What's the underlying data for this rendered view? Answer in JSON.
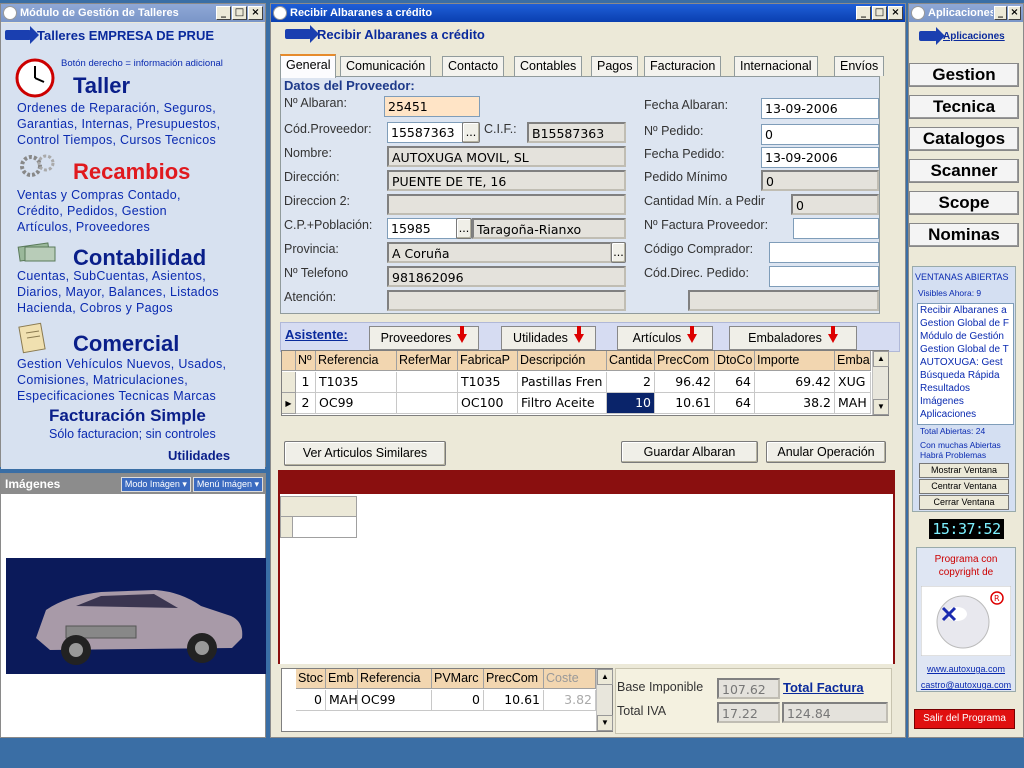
{
  "left_window": {
    "title": "Módulo de Gestión de Talleres",
    "header": "Talleres EMPRESA DE PRUE",
    "hint": "Botón derecho = información adicional",
    "modules": [
      {
        "title": "Taller",
        "lines": [
          "Ordenes de Reparación, Seguros,",
          "Garantias, Internas, Presupuestos,",
          "Control Tiempos, Cursos Tecnicos"
        ]
      },
      {
        "title": "Recambios",
        "lines": [
          "Ventas y Compras Contado,",
          "Crédito, Pedidos,  Gestion",
          "Artículos, Proveedores"
        ]
      },
      {
        "title": "Contabilidad",
        "lines": [
          "Cuentas, SubCuentas, Asientos,",
          "Diarios, Mayor, Balances, Listados",
          "Hacienda, Cobros y Pagos"
        ]
      },
      {
        "title": "Comercial",
        "lines": [
          "Gestion Vehículos Nuevos, Usados,",
          "Comisiones, Matriculaciones,",
          "Especificaciones Tecnicas Marcas"
        ]
      }
    ],
    "fact_simple_title": "Facturación Simple",
    "fact_simple_sub": "Sólo facturacion; sin controles",
    "utilidades": "Utilidades"
  },
  "images_panel": {
    "title": "Imágenes",
    "mode_btn": "Modo Imágen",
    "menu_btn": "Menú Imágen"
  },
  "main_window": {
    "title": "Recibir Albaranes a crédito",
    "header": "Recibir Albaranes a crédito",
    "tabs": [
      "General",
      "Comunicación",
      "Contacto",
      "Contables",
      "Pagos",
      "Facturacion",
      "Internacional",
      "Envíos"
    ],
    "section_title": "Datos del Proveedor:",
    "fields": {
      "albaran_label": "Nº Albaran:",
      "albaran": "25451",
      "cod_prov_label": "Cód.Proveedor:",
      "cod_prov": "15587363",
      "cif_label": "C.I.F.:",
      "cif": "B15587363",
      "nombre_label": "Nombre:",
      "nombre": "AUTOXUGA MOVIL, SL",
      "direccion_label": "Dirección:",
      "direccion": "PUENTE DE TE, 16",
      "direccion2_label": "Direccion 2:",
      "direccion2": "",
      "cp_label": "C.P.+Población:",
      "cp": "15985",
      "poblacion": "Taragoña-Rianxo",
      "provincia_label": "Provincia:",
      "provincia": "A Coruña",
      "telefono_label": "Nº Telefono",
      "telefono": "981862096",
      "atencion_label": "Atención:",
      "atencion": "",
      "fecha_albaran_label": "Fecha Albaran:",
      "fecha_albaran": "13-09-2006",
      "pedido_label": "Nº Pedido:",
      "pedido": "0",
      "fecha_pedido_label": "Fecha Pedido:",
      "fecha_pedido": "13-09-2006",
      "pedido_min_label": "Pedido Mínimo",
      "pedido_min": "0",
      "cant_min_label": "Cantidad Mín. a Pedir",
      "cant_min": "0",
      "factura_prov_label": "Nº Factura Proveedor:",
      "factura_prov": "",
      "comprador_label": "Código Comprador:",
      "comprador": "",
      "cod_direc_label": "Cód.Direc. Pedido:",
      "cod_direc": "",
      "extra": ""
    },
    "asistente_label": "Asistente:",
    "asistente_buttons": [
      "Proveedores",
      "Utilidades",
      "Artículos",
      "Embaladores"
    ],
    "lines_grid": {
      "headers": [
        "Nº",
        "Referencia",
        "ReferMar",
        "FabricaP",
        "Descripción",
        "Cantida",
        "PrecCom",
        "DtoCo",
        "Importe",
        "Emba"
      ],
      "rows": [
        [
          "1",
          "T1035",
          "",
          "T1035",
          "Pastillas Fren",
          "2",
          "96.42",
          "64",
          "69.42",
          "XUG"
        ],
        [
          "2",
          "OC99",
          "",
          "OC100",
          "Filtro Aceite",
          "10",
          "10.61",
          "64",
          "38.2",
          "MAH"
        ]
      ]
    },
    "btn_similares": "Ver Articulos Similares",
    "btn_guardar": "Guardar Albaran",
    "btn_anular": "Anular Operación",
    "stock_grid": {
      "headers": [
        "Stoc",
        "Emb",
        "Referencia",
        "PVMarc",
        "PrecCom",
        "Coste"
      ],
      "rows": [
        [
          "0",
          "MAH",
          "OC99",
          "0",
          "10.61",
          "3.82"
        ]
      ]
    },
    "totals": {
      "base_label": "Base Imponible",
      "base": "107.62",
      "total_factura_label": "Total Factura",
      "iva_label": "Total IVA",
      "iva": "17.22",
      "total": "124.84"
    }
  },
  "right_window": {
    "title": "Aplicaciones",
    "header": "Aplicaciones",
    "apps": [
      "Gestion",
      "Tecnica",
      "Catalogos",
      "Scanner",
      "Scope",
      "Nominas"
    ],
    "open_windows_title": "VENTANAS ABIERTAS",
    "visibles": "Visibles Ahora: 9",
    "open_windows": [
      "Recibir Albaranes a",
      "Gestion Global de F",
      "Módulo de Gestión",
      "Gestion Global de T",
      "AUTOXUGA:  Gest",
      "Búsqueda Rápida",
      "Resultados",
      "Imágenes",
      "Aplicaciones"
    ],
    "total_abiertas": "Total Abiertas: 24",
    "warning1": "Con muchas Abiertas",
    "warning2": "Habrá Problemas",
    "btn_mostrar": "Mostrar Ventana",
    "btn_centrar": "Centrar Ventana",
    "btn_cerrar": "Cerrar Ventana",
    "clock": "15:37:52",
    "copyright1": "Programa con",
    "copyright2": "copyright de",
    "web": "www.autoxuga.com",
    "email": "castro@autoxuga.com",
    "salir": "Salir del Programa"
  }
}
